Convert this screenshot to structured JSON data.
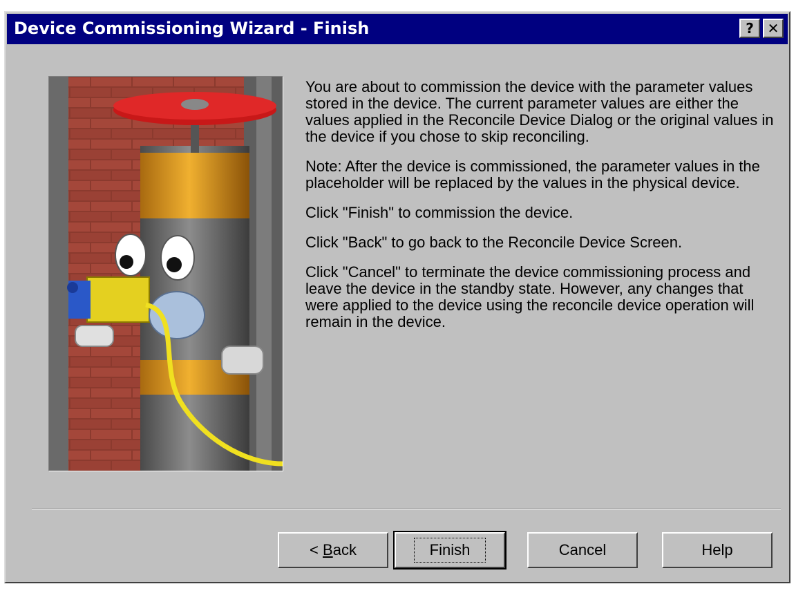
{
  "window": {
    "title": "Device Commissioning Wizard - Finish",
    "help_glyph": "?",
    "close_glyph": "✕"
  },
  "content": {
    "paragraphs": [
      "You are about to commission the device with the parameter values stored in the device. The current parameter values are either the values applied in the Reconcile Device Dialog or the original values in the device if you chose to skip reconciling.",
      "Note: After the device is commissioned, the parameter values in the placeholder will be replaced by the values in the physical device.",
      "Click \"Finish\" to commission the device.",
      "Click \"Back\" to go back to the Reconcile Device Screen.",
      "Click \"Cancel\" to terminate the device commissioning process and leave the device in the standby state. However, any changes that were applied to the device using the reconcile device operation will remain in the device."
    ]
  },
  "buttons": {
    "back_prefix": "< ",
    "back_mnemonic": "B",
    "back_rest": "ack",
    "finish": "Finish",
    "cancel": "Cancel",
    "help": "Help"
  },
  "colors": {
    "titlebar": "#000080",
    "dialog_face": "#c0c0c0",
    "brick": "#8b3a2e",
    "valve_handle": "#d21e1e",
    "cable": "#f0e020"
  }
}
